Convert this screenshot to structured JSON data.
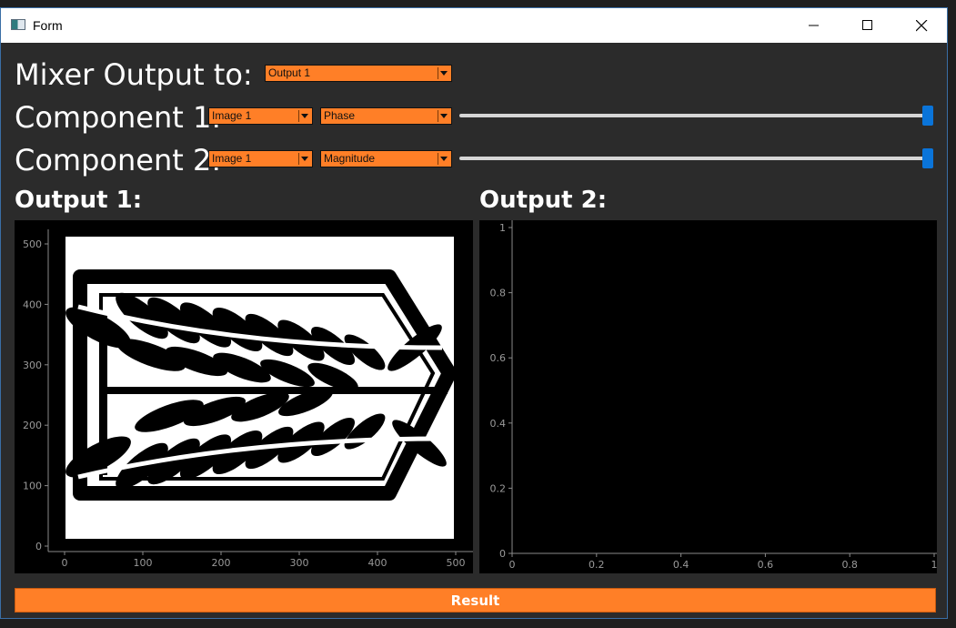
{
  "window": {
    "title": "Form"
  },
  "mixer": {
    "label": "Mixer Output to:",
    "output_select": "Output 1"
  },
  "component1": {
    "label": "Component 1:",
    "image_select": "Image 1",
    "type_select": "Phase",
    "slider_value": 1.0
  },
  "component2": {
    "label": "Component 2:",
    "image_select": "Image 1",
    "type_select": "Magnitude",
    "slider_value": 1.0
  },
  "output1": {
    "title": "Output 1:",
    "x_ticks": [
      "0",
      "100",
      "200",
      "300",
      "400",
      "500"
    ],
    "y_ticks": [
      "0",
      "100",
      "200",
      "300",
      "400",
      "500"
    ],
    "image_content": "black-and-white wings emblem"
  },
  "output2": {
    "title": "Output 2:",
    "x_ticks": [
      "0",
      "0.2",
      "0.4",
      "0.6",
      "0.8",
      "1"
    ],
    "y_ticks": [
      "0",
      "0.2",
      "0.4",
      "0.6",
      "0.8",
      "1"
    ]
  },
  "result_button": "Result",
  "colors": {
    "accent": "#ff7f27",
    "slider_handle": "#0a74d9",
    "background": "#2b2b2b"
  }
}
